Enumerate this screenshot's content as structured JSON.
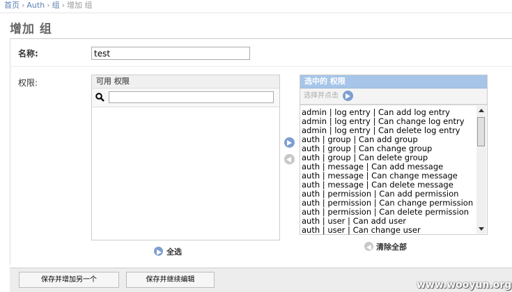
{
  "breadcrumbs": {
    "home": "首页",
    "auth": "Auth",
    "group": "组",
    "current": "增加 组"
  },
  "page_title": "增加 组",
  "form": {
    "name_label": "名称:",
    "name_value": "test",
    "permissions_label": "权限:"
  },
  "available": {
    "header": "可用 权限",
    "filter_placeholder": "",
    "select_all": "全选"
  },
  "chosen": {
    "header": "选中的 权限",
    "hint": "选择并点击",
    "items": [
      "admin | log entry | Can add log entry",
      "admin | log entry | Can change log entry",
      "admin | log entry | Can delete log entry",
      "auth | group | Can add group",
      "auth | group | Can change group",
      "auth | group | Can delete group",
      "auth | message | Can add message",
      "auth | message | Can change message",
      "auth | message | Can delete message",
      "auth | permission | Can add permission",
      "auth | permission | Can change permission",
      "auth | permission | Can delete permission",
      "auth | user | Can add user",
      "auth | user | Can change user"
    ],
    "clear_all": "清除全部"
  },
  "buttons": {
    "save_add_another": "保存并增加另一个",
    "save_continue": "保存并继续编辑"
  },
  "watermark": "www.wooyun.org",
  "colors": {
    "link": "#5b80b2",
    "chosen_header": "#a6c5e8",
    "arrow_button": "#7d9ed0"
  }
}
